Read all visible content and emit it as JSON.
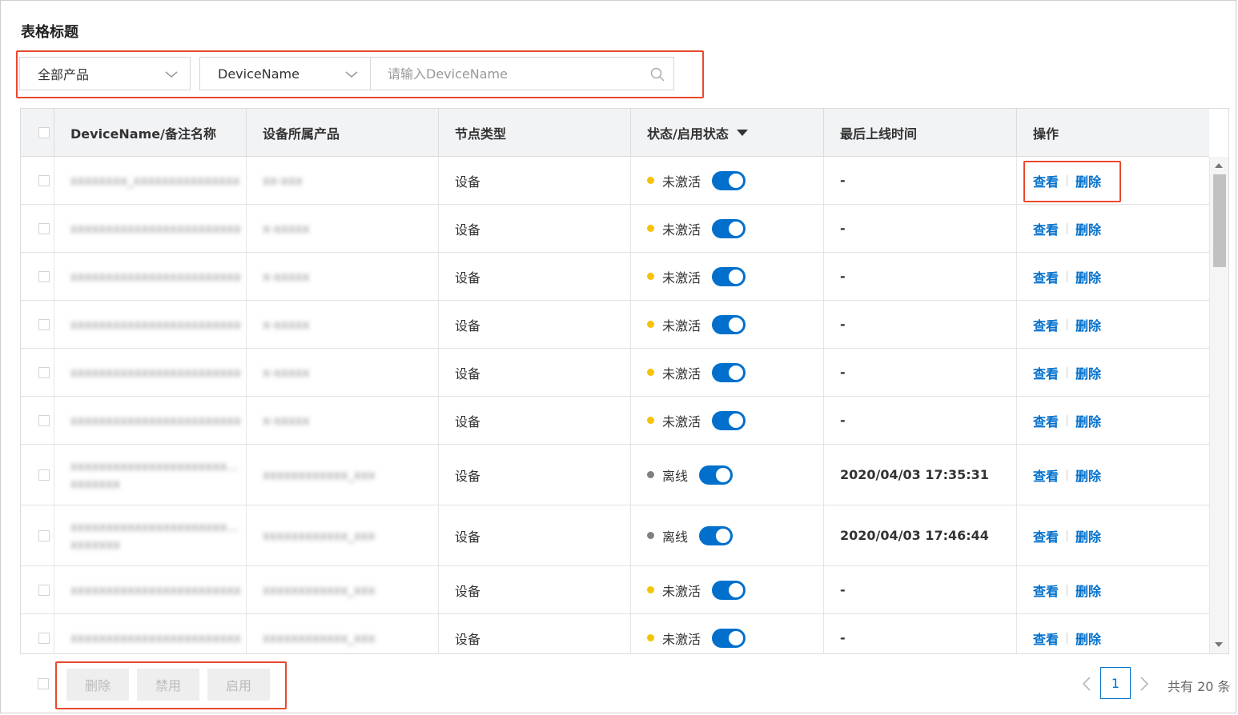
{
  "title": "表格标题",
  "filters": {
    "product_select": "全部产品",
    "field_select": "DeviceName",
    "search_placeholder": "请输入DeviceName"
  },
  "columns": {
    "name": "DeviceName/备注名称",
    "product": "设备所属产品",
    "node_type": "节点类型",
    "status": "状态/启用状态",
    "last_online": "最后上线时间",
    "actions": "操作"
  },
  "rows": [
    {
      "name": "xxxxxxxx_xxxxxxxxxxxxxxx",
      "name2": "",
      "product": "xx-xxx",
      "node": "设备",
      "status": "未激活",
      "status_color": "#f5c400",
      "enabled": true,
      "time": "-"
    },
    {
      "name": "xxxxxxxxxxxxxxxxxxxxxxxx",
      "name2": "",
      "product": "x-xxxxx",
      "node": "设备",
      "status": "未激活",
      "status_color": "#f5c400",
      "enabled": true,
      "time": "-"
    },
    {
      "name": "xxxxxxxxxxxxxxxxxxxxxxxx",
      "name2": "",
      "product": "x-xxxxx",
      "node": "设备",
      "status": "未激活",
      "status_color": "#f5c400",
      "enabled": true,
      "time": "-"
    },
    {
      "name": "xxxxxxxxxxxxxxxxxxxxxxxx",
      "name2": "",
      "product": "x-xxxxx",
      "node": "设备",
      "status": "未激活",
      "status_color": "#f5c400",
      "enabled": true,
      "time": "-"
    },
    {
      "name": "xxxxxxxxxxxxxxxxxxxxxxxx",
      "name2": "",
      "product": "x-xxxxx",
      "node": "设备",
      "status": "未激活",
      "status_color": "#f5c400",
      "enabled": true,
      "time": "-"
    },
    {
      "name": "xxxxxxxxxxxxxxxxxxxxxxxx",
      "name2": "",
      "product": "x-xxxxx",
      "node": "设备",
      "status": "未激活",
      "status_color": "#f5c400",
      "enabled": true,
      "time": "-"
    },
    {
      "name": "xxxxxxxxxxxxxxxxxxxxxx...",
      "name2": "xxxxxxx",
      "product": "xxxxxxxxxxxx_xxx",
      "node": "设备",
      "status": "离线",
      "status_color": "#808080",
      "enabled": true,
      "time": "2020/04/03 17:35:31"
    },
    {
      "name": "xxxxxxxxxxxxxxxxxxxxxx...",
      "name2": "xxxxxxx",
      "product": "xxxxxxxxxxxx_xxx",
      "node": "设备",
      "status": "离线",
      "status_color": "#808080",
      "enabled": true,
      "time": "2020/04/03 17:46:44"
    },
    {
      "name": "xxxxxxxxxxxxxxxxxxxxxxxx",
      "name2": "",
      "product": "xxxxxxxxxxxx_xxx",
      "node": "设备",
      "status": "未激活",
      "status_color": "#f5c400",
      "enabled": true,
      "time": "-"
    },
    {
      "name": "xxxxxxxxxxxxxxxxxxxxxxxx",
      "name2": "",
      "product": "xxxxxxxxxxxx_xxx",
      "node": "设备",
      "status": "未激活",
      "status_color": "#f5c400",
      "enabled": true,
      "time": "-"
    }
  ],
  "actions": {
    "view": "查看",
    "delete": "删除"
  },
  "footer": {
    "batch_delete": "删除",
    "batch_disable": "禁用",
    "batch_enable": "启用"
  },
  "pagination": {
    "current_page": "1",
    "total": "共有 20 条"
  },
  "colors": {
    "accent": "#0070cc",
    "highlight": "#e8492f",
    "inactive": "#f5c400",
    "offline": "#808080"
  }
}
